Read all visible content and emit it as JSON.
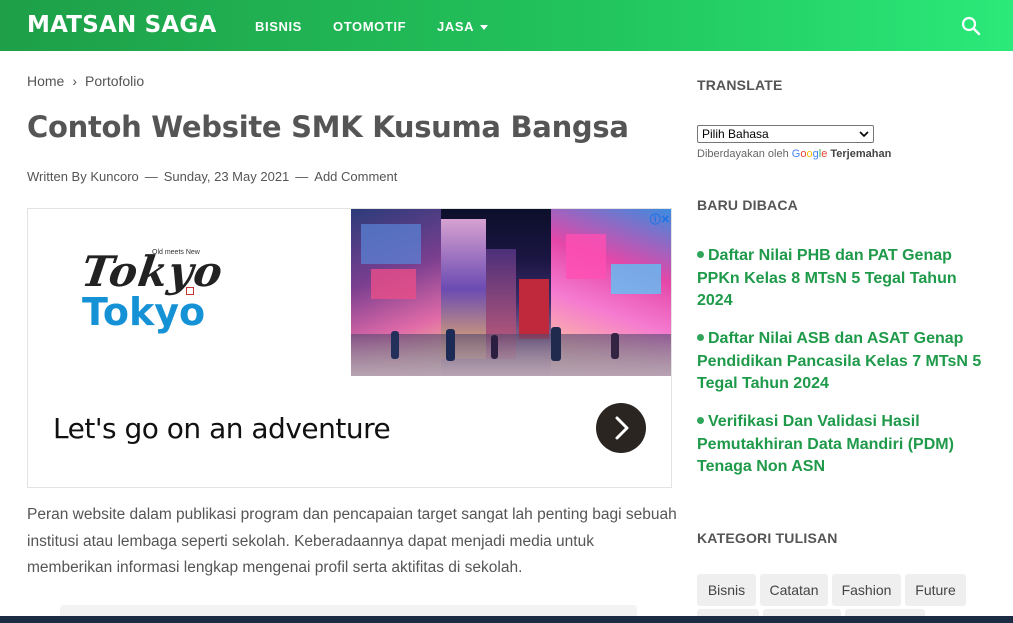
{
  "header": {
    "brand": "MATSAN SAGA",
    "nav": [
      {
        "label": "BISNIS"
      },
      {
        "label": "OTOMOTIF"
      },
      {
        "label": "JASA"
      }
    ]
  },
  "breadcrumb": {
    "home": "Home",
    "separator": "›",
    "current": "Portofolio"
  },
  "post": {
    "title": "Contoh Website SMK Kusuma Bangsa",
    "author": "Written By Kuncoro",
    "date": "Sunday, 23 May 2021",
    "comment": "Add Comment",
    "body": "Peran website dalam publikasi program dan pencapaian target sangat lah penting bagi sebuah institusi atau lembaga seperti sekolah. Keberadaannya dapat menjadi media untuk memberikan informasi lengkap mengenai profil serta aktifitas di sekolah."
  },
  "ad": {
    "logo_top": "Tokyo",
    "logo_small": "Old meets New",
    "logo_bottom": "Tokyo",
    "headline": "Let's go on an adventure",
    "choices": "ⓘ✕"
  },
  "sidebar": {
    "translate_heading": "TRANSLATE",
    "language_select": "Pilih Bahasa",
    "powered_by": "Diberdayakan oleh",
    "google": [
      "G",
      "o",
      "o",
      "g",
      "l",
      "e"
    ],
    "translate_link": "Terjemahan",
    "recent_heading": "BARU DIBACA",
    "recent": [
      "Daftar Nilai PHB dan PAT Genap PPKn Kelas 8 MTsN 5 Tegal Tahun 2024",
      "Daftar Nilai ASB dan ASAT Genap Pendidikan Pancasila Kelas 7 MTsN 5 Tegal Tahun 2024",
      "Verifikasi Dan Validasi Hasil Pemutakhiran Data Mandiri (PDM) Tenaga Non ASN"
    ],
    "category_heading": "KATEGORI TULISAN",
    "categories": [
      "Bisnis",
      "Catatan",
      "Fashion",
      "Future"
    ]
  },
  "colors": {
    "brand_green": "#22c55e",
    "link_green": "#1f9a4a"
  }
}
